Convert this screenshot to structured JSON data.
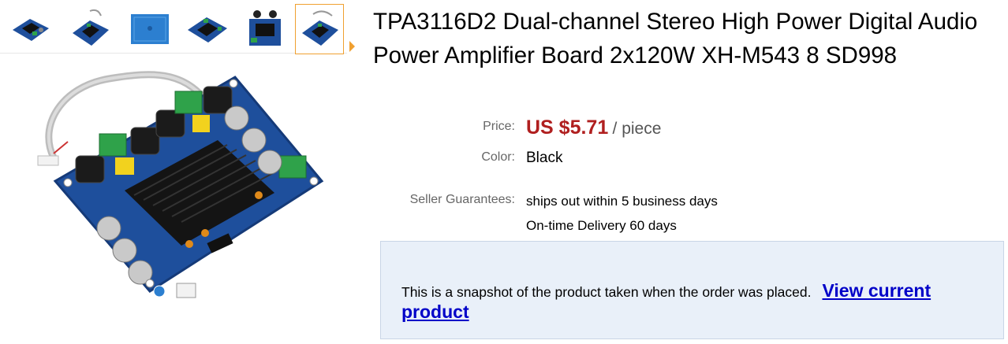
{
  "product": {
    "title": "TPA3116D2 Dual-channel Stereo High Power Digital Audio Power Amplifier Board 2x120W XH-M543 8 SD998"
  },
  "details": {
    "price_label": "Price:",
    "price_value": "US $5.71",
    "price_unit": "/ piece",
    "color_label": "Color:",
    "color_value": "Black",
    "guarantee_label": "Seller Guarantees:",
    "guarantee_line1": "ships out within 5 business days",
    "guarantee_line2": "On-time Delivery 60 days"
  },
  "snapshot": {
    "text": "This is a snapshot of the product taken when the order was placed.",
    "link": "View current product"
  },
  "colors": {
    "price": "#b01f1f",
    "link": "#0000c8",
    "snapshot_bg": "#e9f0f9",
    "thumb_selected_border": "#f0a030",
    "board_blue": "#1e4f9c"
  },
  "gallery": {
    "thumbnail_count": 6,
    "selected_index": 5
  }
}
